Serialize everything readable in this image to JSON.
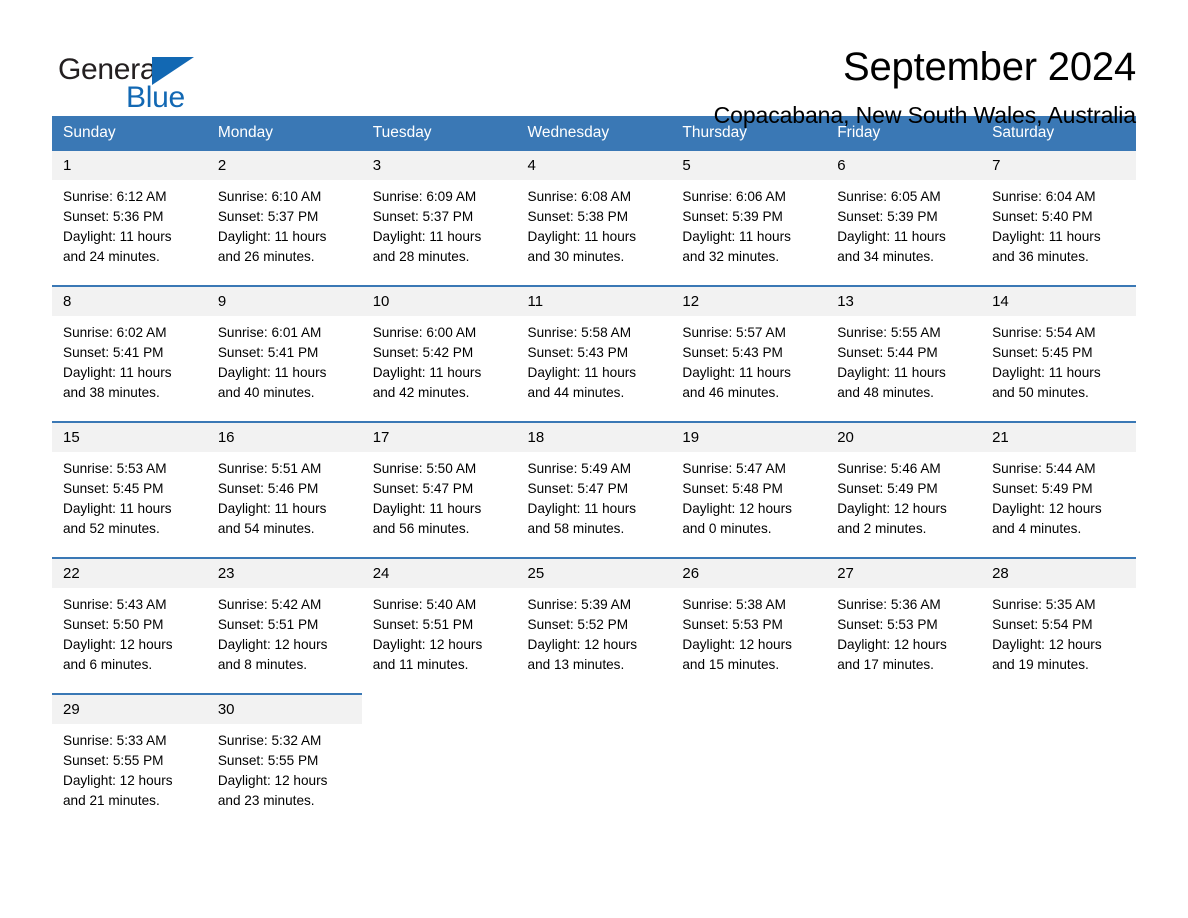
{
  "brand": {
    "name_part1": "General",
    "name_part2": "Blue",
    "triangle_icon": "triangle-icon",
    "accent_color": "#1268b3"
  },
  "header": {
    "title": "September 2024",
    "subtitle": "Copacabana, New South Wales, Australia"
  },
  "colors": {
    "header_blue": "#3a78b5",
    "daynum_band": "#f2f2f2",
    "text": "#000000"
  },
  "weekdays": [
    "Sunday",
    "Monday",
    "Tuesday",
    "Wednesday",
    "Thursday",
    "Friday",
    "Saturday"
  ],
  "weeks": [
    {
      "days": [
        {
          "num": "1",
          "sunrise": "Sunrise: 6:12 AM",
          "sunset": "Sunset: 5:36 PM",
          "daylight1": "Daylight: 11 hours",
          "daylight2": "and 24 minutes."
        },
        {
          "num": "2",
          "sunrise": "Sunrise: 6:10 AM",
          "sunset": "Sunset: 5:37 PM",
          "daylight1": "Daylight: 11 hours",
          "daylight2": "and 26 minutes."
        },
        {
          "num": "3",
          "sunrise": "Sunrise: 6:09 AM",
          "sunset": "Sunset: 5:37 PM",
          "daylight1": "Daylight: 11 hours",
          "daylight2": "and 28 minutes."
        },
        {
          "num": "4",
          "sunrise": "Sunrise: 6:08 AM",
          "sunset": "Sunset: 5:38 PM",
          "daylight1": "Daylight: 11 hours",
          "daylight2": "and 30 minutes."
        },
        {
          "num": "5",
          "sunrise": "Sunrise: 6:06 AM",
          "sunset": "Sunset: 5:39 PM",
          "daylight1": "Daylight: 11 hours",
          "daylight2": "and 32 minutes."
        },
        {
          "num": "6",
          "sunrise": "Sunrise: 6:05 AM",
          "sunset": "Sunset: 5:39 PM",
          "daylight1": "Daylight: 11 hours",
          "daylight2": "and 34 minutes."
        },
        {
          "num": "7",
          "sunrise": "Sunrise: 6:04 AM",
          "sunset": "Sunset: 5:40 PM",
          "daylight1": "Daylight: 11 hours",
          "daylight2": "and 36 minutes."
        }
      ]
    },
    {
      "days": [
        {
          "num": "8",
          "sunrise": "Sunrise: 6:02 AM",
          "sunset": "Sunset: 5:41 PM",
          "daylight1": "Daylight: 11 hours",
          "daylight2": "and 38 minutes."
        },
        {
          "num": "9",
          "sunrise": "Sunrise: 6:01 AM",
          "sunset": "Sunset: 5:41 PM",
          "daylight1": "Daylight: 11 hours",
          "daylight2": "and 40 minutes."
        },
        {
          "num": "10",
          "sunrise": "Sunrise: 6:00 AM",
          "sunset": "Sunset: 5:42 PM",
          "daylight1": "Daylight: 11 hours",
          "daylight2": "and 42 minutes."
        },
        {
          "num": "11",
          "sunrise": "Sunrise: 5:58 AM",
          "sunset": "Sunset: 5:43 PM",
          "daylight1": "Daylight: 11 hours",
          "daylight2": "and 44 minutes."
        },
        {
          "num": "12",
          "sunrise": "Sunrise: 5:57 AM",
          "sunset": "Sunset: 5:43 PM",
          "daylight1": "Daylight: 11 hours",
          "daylight2": "and 46 minutes."
        },
        {
          "num": "13",
          "sunrise": "Sunrise: 5:55 AM",
          "sunset": "Sunset: 5:44 PM",
          "daylight1": "Daylight: 11 hours",
          "daylight2": "and 48 minutes."
        },
        {
          "num": "14",
          "sunrise": "Sunrise: 5:54 AM",
          "sunset": "Sunset: 5:45 PM",
          "daylight1": "Daylight: 11 hours",
          "daylight2": "and 50 minutes."
        }
      ]
    },
    {
      "days": [
        {
          "num": "15",
          "sunrise": "Sunrise: 5:53 AM",
          "sunset": "Sunset: 5:45 PM",
          "daylight1": "Daylight: 11 hours",
          "daylight2": "and 52 minutes."
        },
        {
          "num": "16",
          "sunrise": "Sunrise: 5:51 AM",
          "sunset": "Sunset: 5:46 PM",
          "daylight1": "Daylight: 11 hours",
          "daylight2": "and 54 minutes."
        },
        {
          "num": "17",
          "sunrise": "Sunrise: 5:50 AM",
          "sunset": "Sunset: 5:47 PM",
          "daylight1": "Daylight: 11 hours",
          "daylight2": "and 56 minutes."
        },
        {
          "num": "18",
          "sunrise": "Sunrise: 5:49 AM",
          "sunset": "Sunset: 5:47 PM",
          "daylight1": "Daylight: 11 hours",
          "daylight2": "and 58 minutes."
        },
        {
          "num": "19",
          "sunrise": "Sunrise: 5:47 AM",
          "sunset": "Sunset: 5:48 PM",
          "daylight1": "Daylight: 12 hours",
          "daylight2": "and 0 minutes."
        },
        {
          "num": "20",
          "sunrise": "Sunrise: 5:46 AM",
          "sunset": "Sunset: 5:49 PM",
          "daylight1": "Daylight: 12 hours",
          "daylight2": "and 2 minutes."
        },
        {
          "num": "21",
          "sunrise": "Sunrise: 5:44 AM",
          "sunset": "Sunset: 5:49 PM",
          "daylight1": "Daylight: 12 hours",
          "daylight2": "and 4 minutes."
        }
      ]
    },
    {
      "days": [
        {
          "num": "22",
          "sunrise": "Sunrise: 5:43 AM",
          "sunset": "Sunset: 5:50 PM",
          "daylight1": "Daylight: 12 hours",
          "daylight2": "and 6 minutes."
        },
        {
          "num": "23",
          "sunrise": "Sunrise: 5:42 AM",
          "sunset": "Sunset: 5:51 PM",
          "daylight1": "Daylight: 12 hours",
          "daylight2": "and 8 minutes."
        },
        {
          "num": "24",
          "sunrise": "Sunrise: 5:40 AM",
          "sunset": "Sunset: 5:51 PM",
          "daylight1": "Daylight: 12 hours",
          "daylight2": "and 11 minutes."
        },
        {
          "num": "25",
          "sunrise": "Sunrise: 5:39 AM",
          "sunset": "Sunset: 5:52 PM",
          "daylight1": "Daylight: 12 hours",
          "daylight2": "and 13 minutes."
        },
        {
          "num": "26",
          "sunrise": "Sunrise: 5:38 AM",
          "sunset": "Sunset: 5:53 PM",
          "daylight1": "Daylight: 12 hours",
          "daylight2": "and 15 minutes."
        },
        {
          "num": "27",
          "sunrise": "Sunrise: 5:36 AM",
          "sunset": "Sunset: 5:53 PM",
          "daylight1": "Daylight: 12 hours",
          "daylight2": "and 17 minutes."
        },
        {
          "num": "28",
          "sunrise": "Sunrise: 5:35 AM",
          "sunset": "Sunset: 5:54 PM",
          "daylight1": "Daylight: 12 hours",
          "daylight2": "and 19 minutes."
        }
      ]
    },
    {
      "days": [
        {
          "num": "29",
          "sunrise": "Sunrise: 5:33 AM",
          "sunset": "Sunset: 5:55 PM",
          "daylight1": "Daylight: 12 hours",
          "daylight2": "and 21 minutes."
        },
        {
          "num": "30",
          "sunrise": "Sunrise: 5:32 AM",
          "sunset": "Sunset: 5:55 PM",
          "daylight1": "Daylight: 12 hours",
          "daylight2": "and 23 minutes."
        },
        {
          "num": "",
          "sunrise": "",
          "sunset": "",
          "daylight1": "",
          "daylight2": ""
        },
        {
          "num": "",
          "sunrise": "",
          "sunset": "",
          "daylight1": "",
          "daylight2": ""
        },
        {
          "num": "",
          "sunrise": "",
          "sunset": "",
          "daylight1": "",
          "daylight2": ""
        },
        {
          "num": "",
          "sunrise": "",
          "sunset": "",
          "daylight1": "",
          "daylight2": ""
        },
        {
          "num": "",
          "sunrise": "",
          "sunset": "",
          "daylight1": "",
          "daylight2": ""
        }
      ]
    }
  ]
}
